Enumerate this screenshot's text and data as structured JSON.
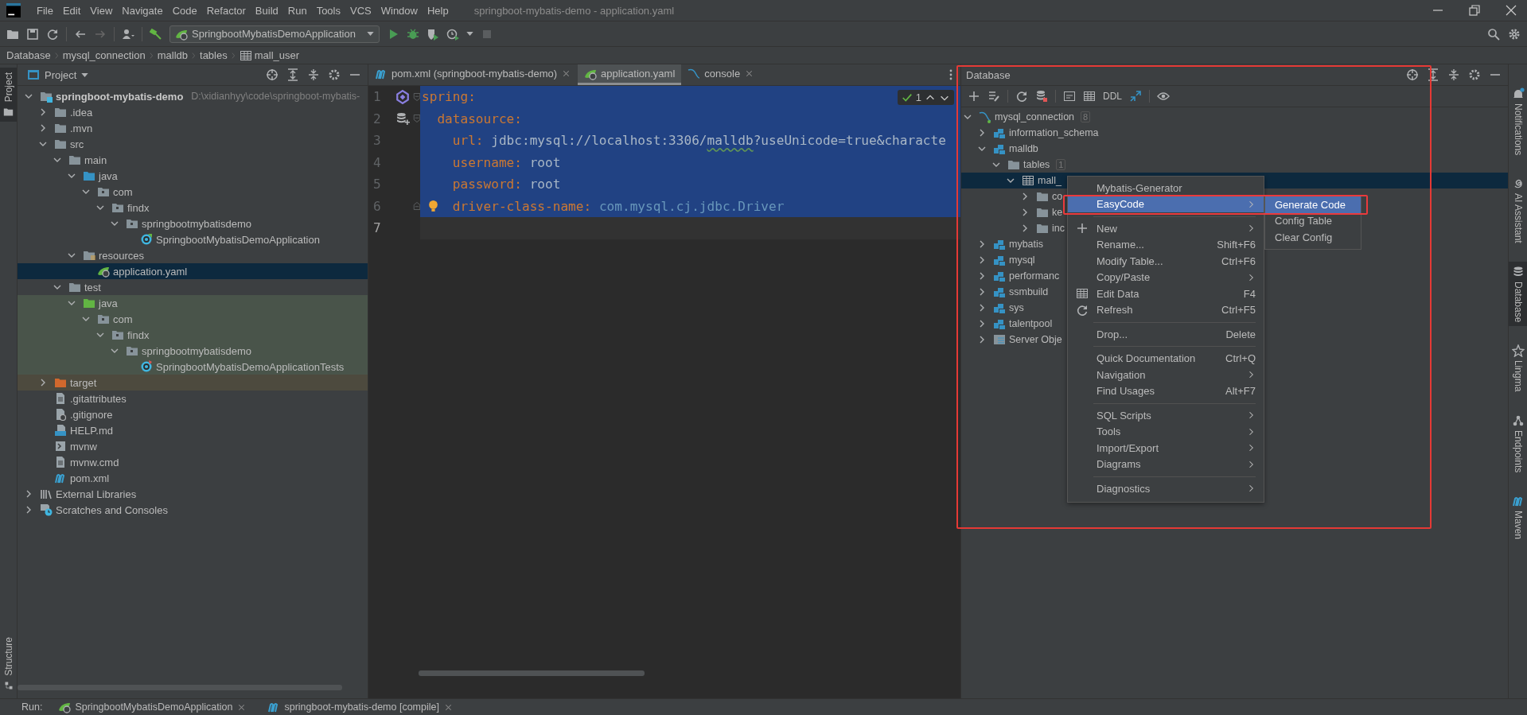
{
  "window": {
    "title": "springboot-mybatis-demo - application.yaml"
  },
  "menu_bar": [
    "File",
    "Edit",
    "View",
    "Navigate",
    "Code",
    "Refactor",
    "Build",
    "Run",
    "Tools",
    "VCS",
    "Window",
    "Help"
  ],
  "toolbar": {
    "run_configuration": "SpringbootMybatisDemoApplication"
  },
  "breadcrumbs": [
    {
      "label": "Database",
      "kind": "plain"
    },
    {
      "label": "mysql_connection",
      "kind": "plain"
    },
    {
      "label": "malldb",
      "kind": "plain"
    },
    {
      "label": "tables",
      "kind": "plain"
    },
    {
      "label": "mall_user",
      "kind": "table"
    }
  ],
  "left_stripe": {
    "top": [
      {
        "label": "Project",
        "selected": true
      }
    ],
    "bottom": [
      {
        "label": "Structure",
        "selected": false
      }
    ]
  },
  "project": {
    "title": "Project",
    "tree": [
      {
        "label": "springboot-mybatis-demo",
        "hint": "D:\\xidianhyy\\code\\springboot-mybatis-",
        "kind": "module",
        "expanded": true,
        "selected": false,
        "children": [
          {
            "label": ".idea",
            "kind": "folder",
            "expanded": false,
            "selected": false
          },
          {
            "label": ".mvn",
            "kind": "folder",
            "expanded": false,
            "selected": false
          },
          {
            "label": "src",
            "kind": "folder",
            "expanded": true,
            "selected": false,
            "children": [
              {
                "label": "main",
                "kind": "folder",
                "expanded": true,
                "selected": false,
                "children": [
                  {
                    "label": "java",
                    "kind": "source-folder",
                    "expanded": true,
                    "selected": false,
                    "children": [
                      {
                        "label": "com",
                        "kind": "package",
                        "expanded": true,
                        "selected": false,
                        "children": [
                          {
                            "label": "findx",
                            "kind": "package",
                            "expanded": true,
                            "selected": false,
                            "children": [
                              {
                                "label": "springbootmybatisdemo",
                                "kind": "package",
                                "expanded": true,
                                "selected": false,
                                "children": [
                                  {
                                    "label": "SpringbootMybatisDemoApplication",
                                    "kind": "spring-class",
                                    "selected": false
                                  }
                                ]
                              }
                            ]
                          }
                        ]
                      }
                    ]
                  },
                  {
                    "label": "resources",
                    "kind": "resource-folder",
                    "expanded": true,
                    "selected": false,
                    "children": [
                      {
                        "label": "application.yaml",
                        "kind": "yaml-file",
                        "selected": true
                      }
                    ]
                  }
                ]
              },
              {
                "label": "test",
                "kind": "folder",
                "expanded": true,
                "selected": false,
                "children": [
                  {
                    "label": "java",
                    "kind": "test-folder",
                    "expanded": true,
                    "selected": false,
                    "children": [
                      {
                        "label": "com",
                        "kind": "package",
                        "expanded": true,
                        "selected": false,
                        "children": [
                          {
                            "label": "findx",
                            "kind": "package",
                            "expanded": true,
                            "selected": false,
                            "children": [
                              {
                                "label": "springbootmybatisdemo",
                                "kind": "package",
                                "expanded": true,
                                "selected": false,
                                "children": [
                                  {
                                    "label": "SpringbootMybatisDemoApplicationTests",
                                    "kind": "test-class",
                                    "selected": false
                                  }
                                ]
                              }
                            ]
                          }
                        ]
                      }
                    ]
                  }
                ]
              }
            ]
          },
          {
            "label": "target",
            "kind": "excluded-folder",
            "expanded": false,
            "selected": false
          },
          {
            "label": ".gitattributes",
            "kind": "text-file",
            "selected": false
          },
          {
            "label": ".gitignore",
            "kind": "ignore-file",
            "selected": false
          },
          {
            "label": "HELP.md",
            "kind": "md-file",
            "selected": false
          },
          {
            "label": "mvnw",
            "kind": "script-file",
            "selected": false
          },
          {
            "label": "mvnw.cmd",
            "kind": "text-file",
            "selected": false
          },
          {
            "label": "pom.xml",
            "kind": "pom-file",
            "selected": false
          }
        ]
      },
      {
        "label": "External Libraries",
        "kind": "libraries",
        "expanded": false,
        "selected": false
      },
      {
        "label": "Scratches and Consoles",
        "kind": "scratches",
        "expanded": false,
        "selected": false
      }
    ]
  },
  "editor": {
    "tabs": [
      {
        "label": "pom.xml (springboot-mybatis-demo)",
        "kind": "maven",
        "selected": false,
        "closable": true
      },
      {
        "label": "application.yaml",
        "kind": "yaml",
        "selected": true,
        "closable": false
      },
      {
        "label": "console",
        "kind": "console",
        "selected": false,
        "closable": true
      }
    ],
    "inspection_count": "1",
    "lines": [
      {
        "number": "1",
        "selected": true,
        "current": false,
        "tokens": [
          {
            "text": "spring",
            "kind": "key"
          },
          {
            "text": ":",
            "kind": "punct"
          }
        ]
      },
      {
        "number": "2",
        "selected": true,
        "current": false,
        "tokens": [
          {
            "text": "  datasource",
            "kind": "key"
          },
          {
            "text": ":",
            "kind": "punct"
          }
        ]
      },
      {
        "number": "3",
        "selected": true,
        "current": false,
        "tokens": [
          {
            "text": "    url",
            "kind": "key"
          },
          {
            "text": ": ",
            "kind": "punct"
          },
          {
            "text": "jdbc:mysql://localhost:3306/",
            "kind": "value"
          },
          {
            "text": "malldb",
            "kind": "typo"
          },
          {
            "text": "?useUnicode=true&characte",
            "kind": "value"
          }
        ]
      },
      {
        "number": "4",
        "selected": true,
        "current": false,
        "tokens": [
          {
            "text": "    username",
            "kind": "key"
          },
          {
            "text": ": ",
            "kind": "punct"
          },
          {
            "text": "root",
            "kind": "value"
          }
        ]
      },
      {
        "number": "5",
        "selected": true,
        "current": false,
        "tokens": [
          {
            "text": "    password",
            "kind": "key"
          },
          {
            "text": ": ",
            "kind": "punct"
          },
          {
            "text": "root",
            "kind": "value"
          }
        ]
      },
      {
        "number": "6",
        "selected": true,
        "current": false,
        "tokens": [
          {
            "text": "    driver-class-name",
            "kind": "key"
          },
          {
            "text": ": ",
            "kind": "punct"
          },
          {
            "text": "com.mysql.cj.jdbc.Driver",
            "kind": "classref"
          }
        ]
      },
      {
        "number": "7",
        "selected": false,
        "current": true
      }
    ]
  },
  "database": {
    "title": "Database",
    "toolbar_label": "DDL",
    "tree": [
      {
        "label": "mysql_connection",
        "kind": "connection",
        "count": "8",
        "expanded": true,
        "selected": false,
        "children": [
          {
            "label": "information_schema",
            "kind": "schema",
            "expanded": false,
            "selected": false
          },
          {
            "label": "malldb",
            "kind": "schema",
            "expanded": true,
            "selected": false,
            "children": [
              {
                "label": "tables",
                "kind": "folder",
                "count": "1",
                "expanded": true,
                "selected": false,
                "children": [
                  {
                    "label": "mall_",
                    "kind": "table",
                    "expanded": true,
                    "selected": true,
                    "children": [
                      {
                        "label": "co",
                        "kind": "folder",
                        "expanded": false,
                        "selected": false
                      },
                      {
                        "label": "ke",
                        "kind": "folder",
                        "expanded": false,
                        "selected": false
                      },
                      {
                        "label": "inc",
                        "kind": "folder",
                        "expanded": false,
                        "selected": false
                      }
                    ]
                  }
                ]
              }
            ]
          },
          {
            "label": "mybatis",
            "kind": "schema",
            "expanded": false,
            "selected": false
          },
          {
            "label": "mysql",
            "kind": "schema",
            "expanded": false,
            "selected": false
          },
          {
            "label": "performanc",
            "kind": "schema",
            "expanded": false,
            "selected": false
          },
          {
            "label": "ssmbuild",
            "kind": "schema",
            "expanded": false,
            "selected": false
          },
          {
            "label": "sys",
            "kind": "schema",
            "expanded": false,
            "selected": false
          },
          {
            "label": "talentpool",
            "kind": "schema",
            "expanded": false,
            "selected": false
          },
          {
            "label": "Server Obje",
            "kind": "server-objects",
            "expanded": false,
            "selected": false
          }
        ]
      }
    ]
  },
  "context_menu": {
    "items": [
      {
        "kind": "item",
        "label": "Mybatis-Generator",
        "submenu": false,
        "selected": false
      },
      {
        "kind": "item",
        "label": "EasyCode",
        "submenu": true,
        "selected": true
      },
      {
        "kind": "separator"
      },
      {
        "kind": "item",
        "label": "New",
        "submenu": true,
        "selected": false
      },
      {
        "kind": "item",
        "label": "Rename...",
        "shortcut": "Shift+F6",
        "submenu": false,
        "selected": false
      },
      {
        "kind": "item",
        "label": "Modify Table...",
        "shortcut": "Ctrl+F6",
        "submenu": false,
        "selected": false
      },
      {
        "kind": "item",
        "label": "Copy/Paste",
        "submenu": true,
        "selected": false
      },
      {
        "kind": "item",
        "label": "Edit Data",
        "shortcut": "F4",
        "submenu": false,
        "selected": false
      },
      {
        "kind": "item",
        "label": "Refresh",
        "shortcut": "Ctrl+F5",
        "submenu": false,
        "selected": false
      },
      {
        "kind": "separator"
      },
      {
        "kind": "item",
        "label": "Drop...",
        "shortcut": "Delete",
        "submenu": false,
        "selected": false
      },
      {
        "kind": "separator"
      },
      {
        "kind": "item",
        "label": "Quick Documentation",
        "shortcut": "Ctrl+Q",
        "submenu": false,
        "selected": false
      },
      {
        "kind": "item",
        "label": "Navigation",
        "submenu": true,
        "selected": false
      },
      {
        "kind": "item",
        "label": "Find Usages",
        "shortcut": "Alt+F7",
        "submenu": false,
        "selected": false
      },
      {
        "kind": "separator"
      },
      {
        "kind": "item",
        "label": "SQL Scripts",
        "submenu": true,
        "selected": false
      },
      {
        "kind": "item",
        "label": "Tools",
        "submenu": true,
        "selected": false
      },
      {
        "kind": "item",
        "label": "Import/Export",
        "submenu": true,
        "selected": false
      },
      {
        "kind": "item",
        "label": "Diagrams",
        "submenu": true,
        "selected": false
      },
      {
        "kind": "separator"
      },
      {
        "kind": "item",
        "label": "Diagnostics",
        "submenu": true,
        "selected": false
      }
    ]
  },
  "submenu": {
    "items": [
      {
        "label": "Generate Code",
        "selected": true
      },
      {
        "label": "Config Table",
        "selected": false
      },
      {
        "label": "Clear Config",
        "selected": false
      }
    ]
  },
  "right_stripe": [
    {
      "label": "Notifications",
      "selected": false
    },
    {
      "label": "AI Assistant",
      "selected": false
    },
    {
      "label": "Database",
      "selected": true
    },
    {
      "label": "Lingma",
      "selected": false
    },
    {
      "label": "Endpoints",
      "selected": false
    },
    {
      "label": "Maven",
      "selected": false
    }
  ],
  "run_bar": {
    "label": "Run:",
    "tabs": [
      {
        "label": "SpringbootMybatisDemoApplication",
        "kind": "spring"
      },
      {
        "label": "springboot-mybatis-demo [compile]",
        "kind": "maven"
      }
    ]
  },
  "annotations": [
    {
      "kind": "panel-frame"
    },
    {
      "kind": "item-frame"
    }
  ]
}
